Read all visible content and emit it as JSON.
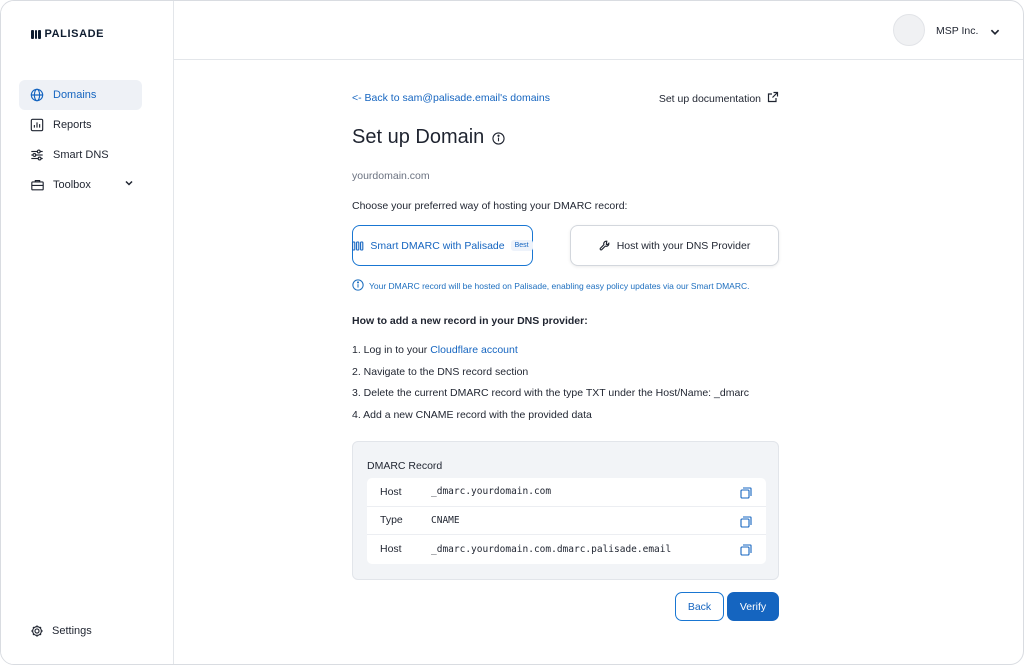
{
  "brand": {
    "name": "PALISADE",
    "accent": "#1565c0"
  },
  "sidebar": {
    "items": [
      {
        "label": "Domains",
        "icon": "globe-icon",
        "active": true
      },
      {
        "label": "Reports",
        "icon": "bar-chart-icon"
      },
      {
        "label": "Smart DNS",
        "icon": "sliders-icon"
      },
      {
        "label": "Toolbox",
        "icon": "briefcase-icon"
      }
    ],
    "settings_label": "Settings"
  },
  "header": {
    "org_name": "MSP Inc."
  },
  "main": {
    "back_link": "<- Back to sam@palisade.email's domains",
    "doc_link": "Set up documentation",
    "title": "Set up Domain",
    "domain": "yourdomain.com",
    "choose_label": "Choose your preferred way of hosting your DMARC record:",
    "options": {
      "smart": "Smart DMARC with Palisade",
      "smart_badge": "Best",
      "host": "Host with your DNS Provider"
    },
    "hint": "Your DMARC record will be hosted on Palisade, enabling easy policy updates via our Smart DMARC.",
    "howto_title": "How to add a new record in your DNS provider:",
    "steps": {
      "s1_prefix": "1. Log in to your ",
      "s1_link": "Cloudflare  account",
      "s2": "2. Navigate to the DNS record section",
      "s3": "3. Delete the current DMARC record with the type TXT under the Host/Name: _dmarc",
      "s4": "4. Add a new CNAME record with the provided data"
    },
    "record": {
      "title": "DMARC Record",
      "rows": [
        {
          "key": "Host",
          "value": "_dmarc.yourdomain.com"
        },
        {
          "key": "Type",
          "value": "CNAME"
        },
        {
          "key": "Host",
          "value": "_dmarc.yourdomain.com.dmarc.palisade.email"
        }
      ]
    },
    "buttons": {
      "back": "Back",
      "verify": "Verify"
    }
  }
}
